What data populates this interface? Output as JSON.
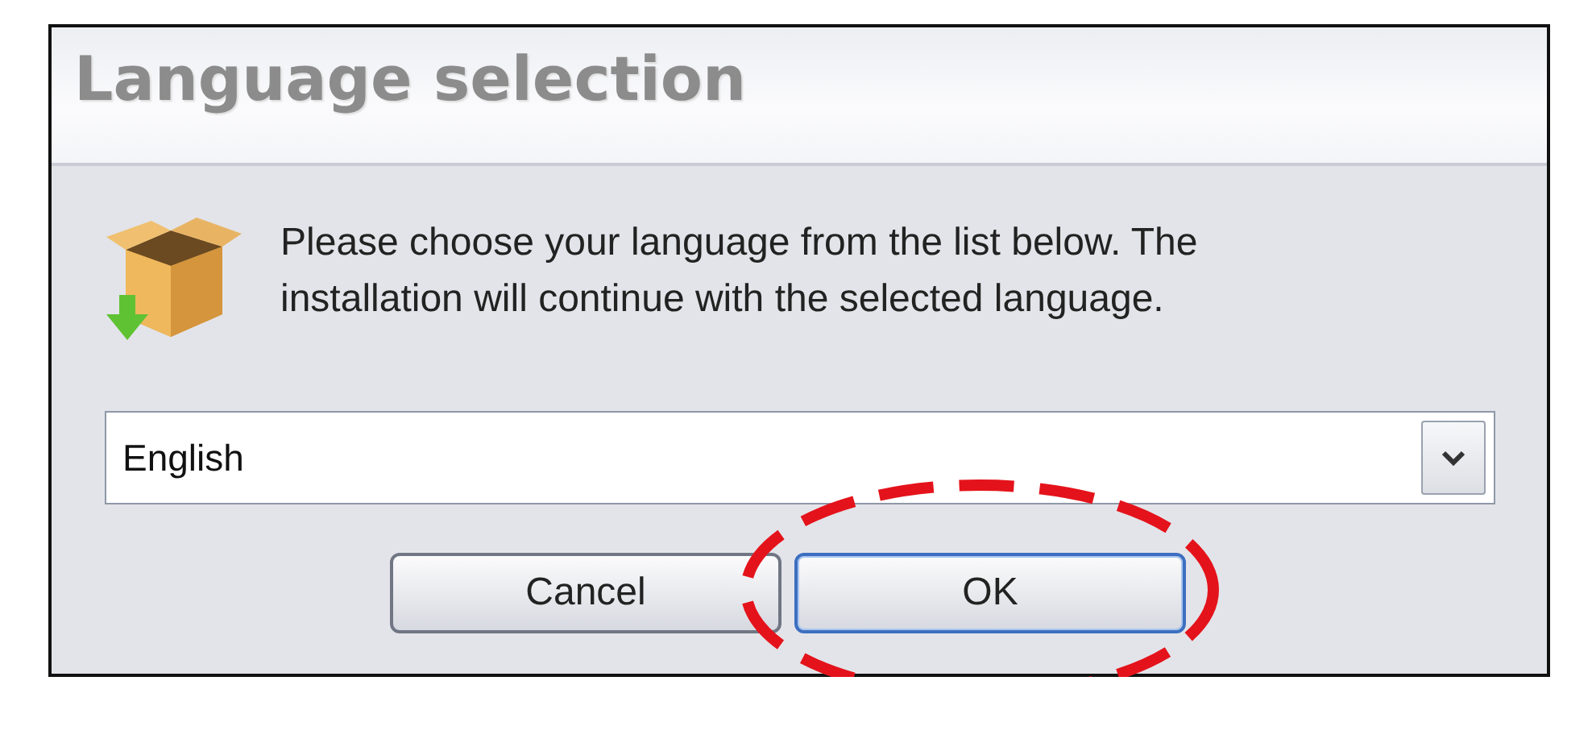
{
  "window": {
    "title": "Language selection"
  },
  "message": "Please choose your language from the list below. The installation will continue with the selected language.",
  "language_select": {
    "value": "English"
  },
  "buttons": [
    {
      "label": "Cancel",
      "default": false,
      "highlighted": false
    },
    {
      "label": "OK",
      "default": true,
      "highlighted": true
    }
  ],
  "annotation": {
    "color": "#e4131b"
  }
}
